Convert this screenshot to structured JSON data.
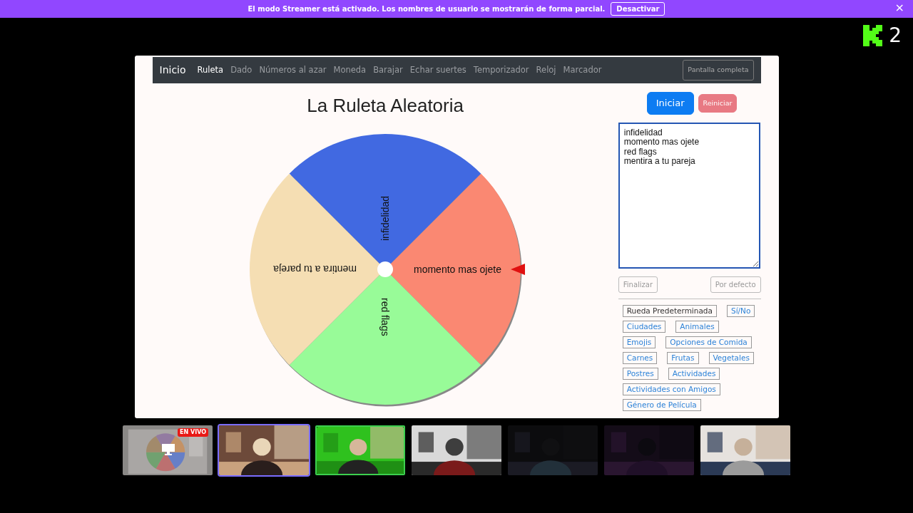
{
  "banner": {
    "message": "El modo Streamer está activado. Los nombres de usuario se mostrarán de forma parcial.",
    "button": "Desactivar",
    "close": "×"
  },
  "viewer_count": "2",
  "navbar": {
    "brand": "Inicio",
    "items": [
      {
        "label": "Ruleta",
        "selected": true
      },
      {
        "label": "Dado",
        "selected": false
      },
      {
        "label": "Números al azar",
        "selected": false
      },
      {
        "label": "Moneda",
        "selected": false
      },
      {
        "label": "Barajar",
        "selected": false
      },
      {
        "label": "Echar suertes",
        "selected": false
      },
      {
        "label": "Temporizador",
        "selected": false
      },
      {
        "label": "Reloj",
        "selected": false
      },
      {
        "label": "Marcador",
        "selected": false
      }
    ],
    "fullscreen_button": "Pantalla completa"
  },
  "title": "La Ruleta Aleatoria",
  "wheel": {
    "segments": [
      {
        "label": "infidelidad",
        "color": "#4169e1"
      },
      {
        "label": "momento mas ojete",
        "color": "#fa8872"
      },
      {
        "label": "red flags",
        "color": "#98fb98"
      },
      {
        "label": "mentira a tu pareja",
        "color": "#f5deb3"
      }
    ]
  },
  "controls": {
    "start": "Iniciar",
    "reset": "Reiniciar",
    "reset_disabled": true
  },
  "entries": [
    "infidelidad",
    "momento mas ojete",
    "red flags",
    "mentira a tu pareja"
  ],
  "entry_buttons": [
    {
      "label": "Finalizar",
      "disabled": true
    },
    {
      "label": "Por defecto",
      "disabled": true
    }
  ],
  "presets": [
    {
      "label": "Rueda Predeterminada",
      "selected": true
    },
    {
      "label": "Sí/No",
      "selected": false
    },
    {
      "label": "Ciudades",
      "selected": false
    },
    {
      "label": "Animales",
      "selected": false
    },
    {
      "label": "Emojis",
      "selected": false
    },
    {
      "label": "Opciones de Comida",
      "selected": false
    },
    {
      "label": "Carnes",
      "selected": false
    },
    {
      "label": "Frutas",
      "selected": false
    },
    {
      "label": "Vegetales",
      "selected": false
    },
    {
      "label": "Postres",
      "selected": false
    },
    {
      "label": "Actividades",
      "selected": false
    },
    {
      "label": "Actividades con Amigos",
      "selected": false
    },
    {
      "label": "Género de Película",
      "selected": false
    }
  ],
  "tiles": [
    {
      "kind": "screen",
      "badge": "EN VIVO",
      "selected": false,
      "speaking": false
    },
    {
      "kind": "camera",
      "selected": true,
      "speaking": false
    },
    {
      "kind": "camera",
      "selected": false,
      "speaking": true
    },
    {
      "kind": "camera",
      "selected": false,
      "speaking": false
    },
    {
      "kind": "camera",
      "selected": false,
      "speaking": false
    },
    {
      "kind": "camera",
      "selected": false,
      "speaking": false
    },
    {
      "kind": "camera",
      "selected": false,
      "speaking": false
    }
  ]
}
